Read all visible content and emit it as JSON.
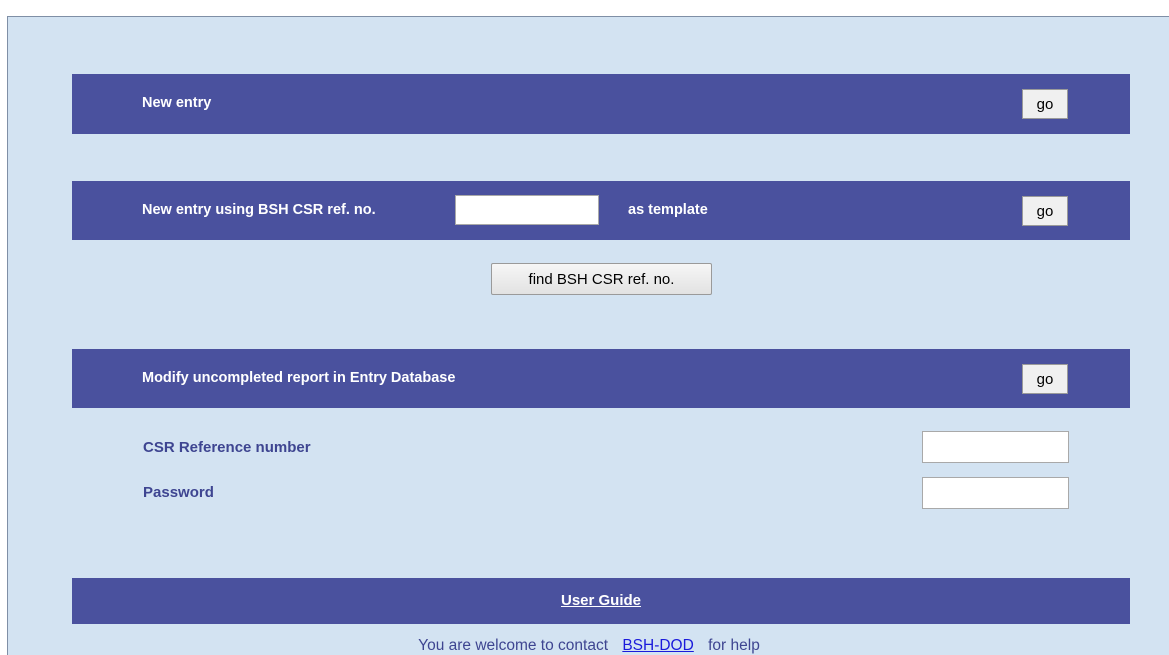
{
  "new_entry": {
    "label": "New entry",
    "go_label": "go"
  },
  "template_entry": {
    "label_before": "New entry using BSH CSR ref. no.",
    "input_value": "",
    "label_after": "as template",
    "go_label": "go"
  },
  "find_button": {
    "label": "find BSH CSR ref. no."
  },
  "modify": {
    "label": "Modify uncompleted report in Entry Database",
    "go_label": "go",
    "csr_label": "CSR Reference number",
    "csr_value": "",
    "password_label": "Password",
    "password_value": ""
  },
  "footer": {
    "guide_label": "User Guide",
    "contact_before": "You are welcome to contact",
    "contact_link": "BSH-DOD",
    "contact_after": "for help"
  },
  "colors": {
    "background": "#d3e3f2",
    "bar": "#4a519e",
    "label_text": "#3e4591",
    "link": "#1a1adb"
  }
}
